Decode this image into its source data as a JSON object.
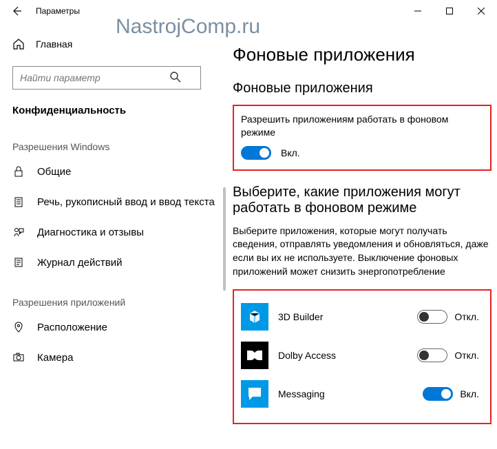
{
  "window": {
    "title": "Параметры"
  },
  "watermark": "NastrojComp.ru",
  "sidebar": {
    "home": "Главная",
    "search_placeholder": "Найти параметр",
    "current_section": "Конфиденциальность",
    "group1_header": "Разрешения Windows",
    "group1": [
      {
        "label": "Общие"
      },
      {
        "label": "Речь, рукописный ввод и ввод текста"
      },
      {
        "label": "Диагностика и отзывы"
      },
      {
        "label": "Журнал действий"
      }
    ],
    "group2_header": "Разрешения приложений",
    "group2": [
      {
        "label": "Расположение"
      },
      {
        "label": "Камера"
      }
    ]
  },
  "main": {
    "heading": "Фоновые приложения",
    "section1_title": "Фоновые приложения",
    "master_toggle_label": "Разрешить приложениям работать в фоновом режиме",
    "master_toggle_state": "Вкл.",
    "section2_title": "Выберите, какие приложения могут работать в фоновом режиме",
    "description": "Выберите приложения, которые могут получать сведения, отправлять уведомления и обновляться, даже если вы их не используете. Выключение фоновых приложений может снизить энергопотребление",
    "apps": [
      {
        "name": "3D Builder",
        "state": "Откл.",
        "on": false,
        "icon": "3dbuilder"
      },
      {
        "name": "Dolby Access",
        "state": "Откл.",
        "on": false,
        "icon": "dolby"
      },
      {
        "name": "Messaging",
        "state": "Вкл.",
        "on": true,
        "icon": "messaging"
      }
    ]
  }
}
